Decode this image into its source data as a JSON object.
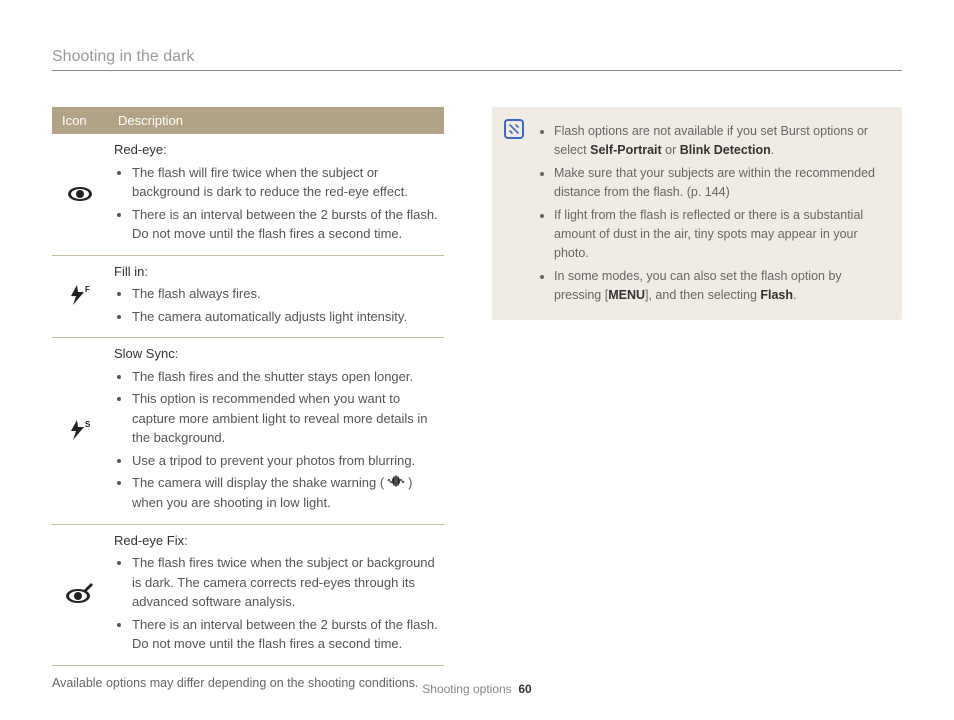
{
  "page_title": "Shooting in the dark",
  "table": {
    "headers": [
      "Icon",
      "Description"
    ],
    "rows": [
      {
        "icon": "eye-icon",
        "title": "Red-eye",
        "bullets": [
          "The flash will fire twice when the subject or background is dark to reduce the red-eye effect.",
          "There is an interval between the 2 bursts of the flash. Do not move until the flash fires a second time."
        ]
      },
      {
        "icon": "flash-f-icon",
        "title": "Fill in",
        "bullets": [
          "The flash always fires.",
          "The camera automatically adjusts light intensity."
        ]
      },
      {
        "icon": "flash-s-icon",
        "title": "Slow Sync",
        "bullets": [
          "The flash fires and the shutter stays open longer.",
          "This option is recommended when you want to capture more ambient light to reveal more details in the background.",
          "Use a tripod to prevent your photos from blurring.",
          "The camera will display the shake warning (  ) when you are shooting in low light."
        ],
        "shake_bullet_index": 3
      },
      {
        "icon": "eye-brush-icon",
        "title": "Red-eye Fix",
        "bullets": [
          "The flash fires twice when the subject or background is dark. The camera corrects red-eyes through its advanced software analysis.",
          "There is an interval between the 2 bursts of the flash. Do not move until the flash fires a second time."
        ]
      }
    ]
  },
  "footnote": "Available options may differ depending on the shooting conditions.",
  "notes": {
    "items": [
      {
        "prefix": "Flash options are not available if you set Burst options or select ",
        "bold1": "Self-Portrait",
        "mid": " or ",
        "bold2": "Blink Detection",
        "suffix": "."
      },
      {
        "text": "Make sure that your subjects are within the recommended distance from the flash. (p. 144)"
      },
      {
        "text": "If light from the flash is reflected or there is a substantial amount of dust in the air, tiny spots may appear in your photo."
      },
      {
        "prefix": "In some modes, you can also set the flash option by pressing [",
        "bold1": "MENU",
        "mid": "], and then selecting ",
        "bold2": "Flash",
        "suffix": "."
      }
    ]
  },
  "footer": {
    "section": "Shooting options",
    "page": "60"
  }
}
